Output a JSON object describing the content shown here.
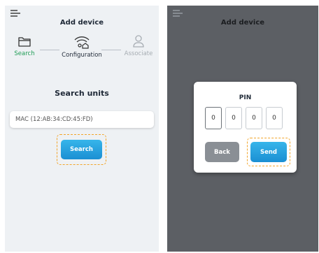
{
  "left_screen": {
    "header": {
      "title": "Add device"
    },
    "stepper": {
      "steps": [
        {
          "label": "Search",
          "icon": "folder-icon",
          "state": "active",
          "color": "#1f9d55"
        },
        {
          "label": "Configuration",
          "icon": "wifi-home-icon",
          "state": "current",
          "color": "#1f2937"
        },
        {
          "label": "Associate",
          "icon": "user-icon",
          "state": "inactive",
          "color": "#a7adb3"
        }
      ]
    },
    "section_title": "Search units",
    "mac_input": {
      "placeholder": "MAC (12:AB:34:CD:45:FD)",
      "value": ""
    },
    "search_button": "Search"
  },
  "right_screen": {
    "header": {
      "title": "Add device"
    },
    "dialog": {
      "title": "PIN",
      "digits": [
        "0",
        "0",
        "0",
        "0"
      ],
      "back_button": "Back",
      "send_button": "Send"
    }
  },
  "colors": {
    "accent_blue": "#2aa6e4",
    "highlight_dash": "#f2a52a",
    "overlay": "#5c5f64",
    "step_active": "#1f9d55"
  }
}
